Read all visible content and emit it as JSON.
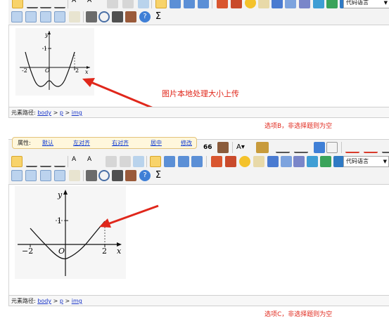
{
  "panel_top": {
    "code_lang": "代码语言",
    "path_label": "元素路径:",
    "path": [
      "body",
      "p",
      "img"
    ],
    "path_sep": ">",
    "annotation": "图片本地处理大小上传",
    "option_note": "选项B，非选择题则为空"
  },
  "panel_bottom": {
    "prop_label": "属性:",
    "prop_links": [
      "默认",
      "左对齐",
      "右对齐",
      "居中",
      "修改"
    ],
    "code_lang": "代码语言",
    "path_label": "元素路径:",
    "path": [
      "body",
      "p",
      "img"
    ],
    "path_sep": ">",
    "option_note": "选项C，非选择题则为空"
  },
  "graph_b": {
    "y": "y",
    "x": "x",
    "one": "1",
    "neg2": "-2",
    "origin": "O",
    "two": "2"
  },
  "graph_c": {
    "y": "y",
    "x": "x",
    "one": "1",
    "neg2": "−2",
    "origin": "O",
    "two": "2"
  },
  "toolbar_text": {
    "font_a": "A",
    "sigma": "Σ",
    "quote": "66"
  },
  "colors": {
    "accent_red": "#e0271b",
    "active_btn": "#f8d36a",
    "toolbar_bg": "#f3f3f3"
  }
}
